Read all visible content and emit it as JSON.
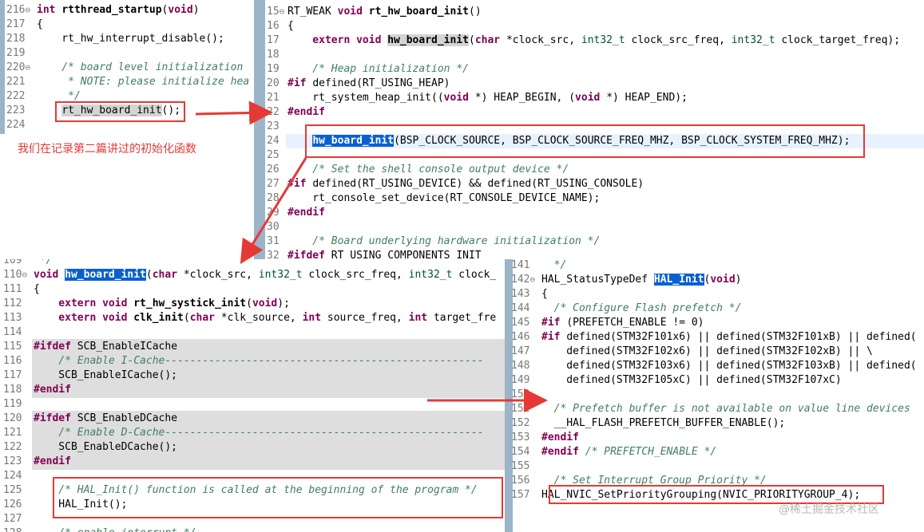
{
  "note": "我们在记录第二篇讲过的初始化函数",
  "watermark": "@稀土掘金技术社区",
  "panes": {
    "p1": [
      {
        "n": "216",
        "f": "⊖",
        "t": [
          [
            "kw",
            "int "
          ],
          [
            "fn",
            "rtthread_startup"
          ],
          [
            "",
            "("
          ],
          [
            "kw",
            "void"
          ],
          [
            "",
            ")"
          ]
        ]
      },
      {
        "n": "217",
        "t": [
          [
            "",
            "{"
          ]
        ]
      },
      {
        "n": "218",
        "t": [
          [
            "",
            "    rt_hw_interrupt_disable();"
          ]
        ]
      },
      {
        "n": "219",
        "t": [
          [
            "",
            ""
          ]
        ]
      },
      {
        "n": "220",
        "f": "⊖",
        "t": [
          [
            "cm",
            "    /* board level initialization"
          ]
        ]
      },
      {
        "n": "221",
        "t": [
          [
            "cm",
            "     * NOTE: please initialize hea"
          ]
        ]
      },
      {
        "n": "222",
        "t": [
          [
            "cm",
            "     */"
          ]
        ]
      },
      {
        "n": "223",
        "t": [
          [
            "",
            "    "
          ],
          [
            "hlsel",
            "rt_hw_board_init"
          ],
          [
            "",
            "();"
          ]
        ]
      },
      {
        "n": "224",
        "t": [
          [
            "",
            ""
          ]
        ]
      }
    ],
    "p2": [
      {
        "n": "15",
        "f": "⊖",
        "t": [
          [
            "",
            "RT_WEAK "
          ],
          [
            "kw",
            "void "
          ],
          [
            "fn",
            "rt_hw_board_init"
          ],
          [
            "",
            "()"
          ]
        ]
      },
      {
        "n": "16",
        "t": [
          [
            "",
            "{"
          ]
        ]
      },
      {
        "n": "17",
        "t": [
          [
            "kw",
            "    extern void "
          ],
          [
            "hlg",
            "hw_board_init"
          ],
          [
            "",
            "("
          ],
          [
            "kw",
            "char "
          ],
          [
            "",
            "*clock_src, "
          ],
          [
            "typ",
            "int32_t"
          ],
          [
            "",
            " clock_src_freq, "
          ],
          [
            "typ",
            "int32_t"
          ],
          [
            "",
            " clock_target_freq);"
          ]
        ]
      },
      {
        "n": "18",
        "t": [
          [
            "",
            ""
          ]
        ]
      },
      {
        "n": "19",
        "t": [
          [
            "cm",
            "    /* Heap initialization */"
          ]
        ]
      },
      {
        "n": "20",
        "t": [
          [
            "kw",
            "#if "
          ],
          [
            "",
            "defined(RT_USING_HEAP)"
          ]
        ]
      },
      {
        "n": "21",
        "t": [
          [
            "",
            "    rt_system_heap_init(("
          ],
          [
            "kw",
            "void "
          ],
          [
            "",
            "*) HEAP_BEGIN, ("
          ],
          [
            "kw",
            "void "
          ],
          [
            "",
            "*) HEAP_END);"
          ]
        ]
      },
      {
        "n": "22",
        "t": [
          [
            "kw",
            "#endif"
          ]
        ]
      },
      {
        "n": "23",
        "t": [
          [
            "",
            ""
          ]
        ]
      },
      {
        "n": "24",
        "t": [
          [
            "",
            "    "
          ],
          [
            "hl",
            "hw_board_init"
          ],
          [
            "",
            "(BSP_CLOCK_SOURCE, BSP_CLOCK_SOURCE_FREQ_MHZ, BSP_CLOCK_SYSTEM_FREQ_MHZ);"
          ]
        ]
      },
      {
        "n": "25",
        "t": [
          [
            "",
            ""
          ]
        ]
      },
      {
        "n": "26",
        "t": [
          [
            "cm",
            "    /* Set the shell console output device */"
          ]
        ]
      },
      {
        "n": "27",
        "t": [
          [
            "kw",
            "#if "
          ],
          [
            "",
            "defined(RT_USING_DEVICE) && defined(RT_USING_CONSOLE)"
          ]
        ]
      },
      {
        "n": "28",
        "t": [
          [
            "",
            "    rt_console_set_device(RT_CONSOLE_DEVICE_NAME);"
          ]
        ]
      },
      {
        "n": "29",
        "t": [
          [
            "kw",
            "#endif"
          ]
        ]
      },
      {
        "n": "30",
        "t": [
          [
            "",
            ""
          ]
        ]
      },
      {
        "n": "31",
        "t": [
          [
            "cm",
            "    /* Board underlying hardware initialization */"
          ]
        ]
      },
      {
        "n": "32",
        "t": [
          [
            "kw",
            "#ifdef "
          ],
          [
            "",
            "RT_USING_COMPONENTS_INIT"
          ]
        ]
      }
    ],
    "p3": [
      {
        "n": "109",
        "t": [
          [
            "cm",
            " */"
          ]
        ]
      },
      {
        "n": "110",
        "f": "⊖",
        "t": [
          [
            "kw",
            "void "
          ],
          [
            "hl",
            "hw_board_init"
          ],
          [
            "",
            "("
          ],
          [
            "kw",
            "char "
          ],
          [
            "",
            "*clock_src, "
          ],
          [
            "typ",
            "int32_t"
          ],
          [
            "",
            " clock_src_freq, "
          ],
          [
            "typ",
            "int32_t"
          ],
          [
            "",
            " clock_"
          ]
        ]
      },
      {
        "n": "111",
        "t": [
          [
            "",
            "{"
          ]
        ]
      },
      {
        "n": "112",
        "t": [
          [
            "kw",
            "    extern void "
          ],
          [
            "fn",
            "rt_hw_systick_init"
          ],
          [
            "",
            "("
          ],
          [
            "kw",
            "void"
          ],
          [
            "",
            ");"
          ]
        ]
      },
      {
        "n": "113",
        "t": [
          [
            "kw",
            "    extern void "
          ],
          [
            "fn",
            "clk_init"
          ],
          [
            "",
            "("
          ],
          [
            "kw",
            "char "
          ],
          [
            "",
            "*clk_source, "
          ],
          [
            "kw",
            "int "
          ],
          [
            "",
            "source_freq, "
          ],
          [
            "kw",
            "int "
          ],
          [
            "",
            "target_fre"
          ]
        ]
      },
      {
        "n": "114",
        "t": [
          [
            "",
            ""
          ]
        ]
      },
      {
        "n": "115",
        "t": [
          [
            "kw",
            "#ifdef "
          ],
          [
            "",
            "SCB_EnableICache"
          ]
        ]
      },
      {
        "n": "116",
        "t": [
          [
            "cm",
            "    /* Enable I-Cache---------------------------------------------------"
          ]
        ]
      },
      {
        "n": "117",
        "t": [
          [
            "",
            "    SCB_EnableICache();"
          ]
        ]
      },
      {
        "n": "118",
        "t": [
          [
            "kw",
            "#endif"
          ]
        ]
      },
      {
        "n": "119",
        "t": [
          [
            "",
            ""
          ]
        ]
      },
      {
        "n": "120",
        "t": [
          [
            "kw",
            "#ifdef "
          ],
          [
            "",
            "SCB_EnableDCache"
          ]
        ]
      },
      {
        "n": "121",
        "t": [
          [
            "cm",
            "    /* Enable D-Cache---------------------------------------------------"
          ]
        ]
      },
      {
        "n": "122",
        "t": [
          [
            "",
            "    SCB_EnableDCache();"
          ]
        ]
      },
      {
        "n": "123",
        "t": [
          [
            "kw",
            "#endif"
          ]
        ]
      },
      {
        "n": "124",
        "t": [
          [
            "",
            ""
          ]
        ]
      },
      {
        "n": "125",
        "t": [
          [
            "cm",
            "    /* HAL_Init() function is called at the beginning of the program */"
          ]
        ]
      },
      {
        "n": "126",
        "t": [
          [
            "",
            "    HAL_Init();"
          ]
        ]
      },
      {
        "n": "127",
        "t": [
          [
            "",
            ""
          ]
        ]
      },
      {
        "n": "128",
        "t": [
          [
            "cm",
            "    /* enable interrupt */"
          ]
        ]
      }
    ],
    "p4": [
      {
        "n": "141",
        "t": [
          [
            "cm",
            "  */"
          ]
        ]
      },
      {
        "n": "142",
        "f": "⊖",
        "t": [
          [
            "",
            "HAL_StatusTypeDef "
          ],
          [
            "hl",
            "HAL_Init"
          ],
          [
            "",
            "("
          ],
          [
            "kw",
            "void"
          ],
          [
            "",
            ")"
          ]
        ]
      },
      {
        "n": "143",
        "t": [
          [
            "",
            "{"
          ]
        ]
      },
      {
        "n": "144",
        "t": [
          [
            "cm",
            "  /* Configure Flash prefetch */"
          ]
        ]
      },
      {
        "n": "145",
        "t": [
          [
            "kw",
            "#if "
          ],
          [
            "",
            "(PREFETCH_ENABLE != 0)"
          ]
        ]
      },
      {
        "n": "146",
        "t": [
          [
            "kw",
            "#if "
          ],
          [
            "",
            "defined(STM32F101x6) || defined(STM32F101xB) || defined("
          ]
        ]
      },
      {
        "n": "147",
        "t": [
          [
            "",
            "    defined(STM32F102x6) || defined(STM32F102xB) || \\"
          ]
        ]
      },
      {
        "n": "148",
        "t": [
          [
            "",
            "    defined(STM32F103x6) || defined(STM32F103xB) || defined("
          ]
        ]
      },
      {
        "n": "149",
        "t": [
          [
            "",
            "    defined(STM32F105xC) || defined(STM32F107xC)"
          ]
        ]
      },
      {
        "n": "150",
        "t": [
          [
            "",
            ""
          ]
        ]
      },
      {
        "n": "151",
        "t": [
          [
            "cm",
            "  /* Prefetch buffer is not available on value line devices"
          ]
        ]
      },
      {
        "n": "152",
        "t": [
          [
            "",
            "  __HAL_FLASH_PREFETCH_BUFFER_ENABLE();"
          ]
        ]
      },
      {
        "n": "153",
        "t": [
          [
            "kw",
            "#endif"
          ]
        ]
      },
      {
        "n": "154",
        "t": [
          [
            "kw",
            "#endif "
          ],
          [
            "cm",
            "/* PREFETCH_ENABLE */"
          ]
        ]
      },
      {
        "n": "155",
        "t": [
          [
            "",
            ""
          ]
        ]
      },
      {
        "n": "156",
        "t": [
          [
            "cm",
            "  /* Set Interrupt Group Priority */"
          ]
        ]
      },
      {
        "n": "157",
        "t": [
          [
            "",
            "HAL_NVIC_SetPriorityGrouping(NVIC_PRIORITYGROUP_4);"
          ]
        ]
      }
    ]
  },
  "colors": {
    "accent": "#e53935",
    "selection": "#0a5fd3",
    "gutter": "#9bb4c8"
  }
}
